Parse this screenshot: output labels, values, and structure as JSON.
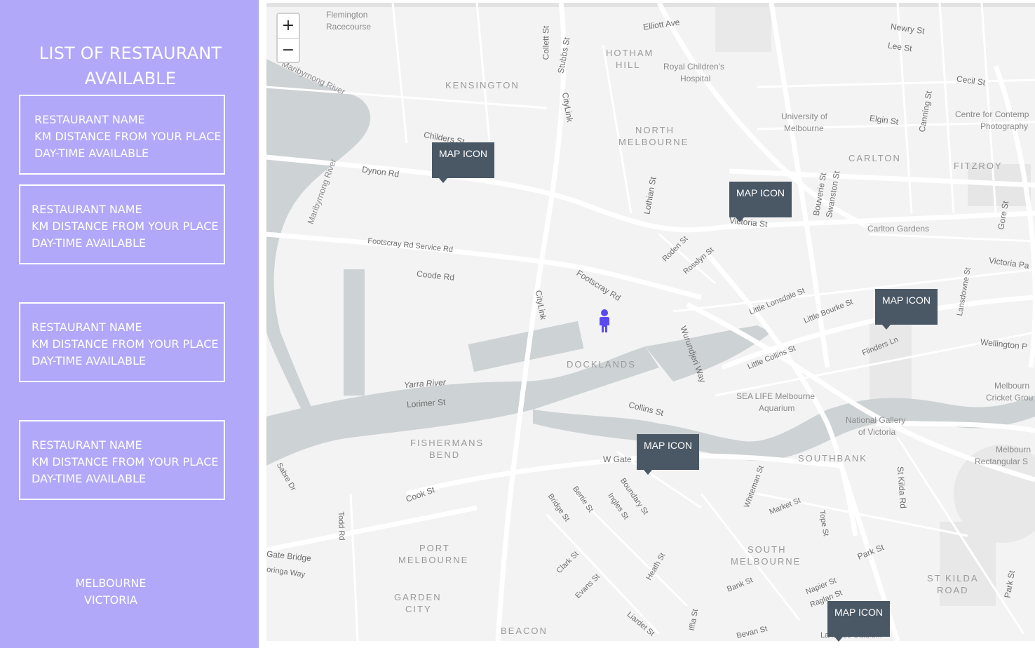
{
  "sidebar": {
    "title_line1": "LIST OF RESTAURANT",
    "title_line2": "AVAILABLE",
    "cards": [
      {
        "name": "RESTAURANT NAME",
        "distance": "KM DISTANCE FROM YOUR PLACE",
        "time": "DAY-TIME AVAILABLE"
      },
      {
        "name": "RESTAURANT NAME",
        "distance": "KM DISTANCE FROM YOUR PLACE",
        "time": "DAY-TIME AVAILABLE"
      },
      {
        "name": "RESTAURANT NAME",
        "distance": "KM DISTANCE FROM YOUR PLACE",
        "time": "DAY-TIME AVAILABLE"
      },
      {
        "name": "RESTAURANT NAME",
        "distance": "KM DISTANCE FROM YOUR PLACE",
        "time": "DAY-TIME AVAILABLE"
      }
    ],
    "location_line1": "MELBOURNE",
    "location_line2": "VICTORIA"
  },
  "map": {
    "zoom_in": "+",
    "zoom_out": "−",
    "markers": [
      "MAP ICON",
      "MAP ICON",
      "MAP ICON",
      "MAP ICON",
      "MAP ICON"
    ],
    "user_icon": "person-icon",
    "labels": {
      "flemington": "Flemington",
      "racecourse": "Racecourse",
      "elliott": "Elliott Ave",
      "newry": "Newry St",
      "lee": "Lee St",
      "hotham1": "HOTHAM",
      "hotham2": "HILL",
      "royal1": "Royal Children's",
      "royal2": "Hospital",
      "kensington": "KENSINGTON",
      "maribyrnong": "Maribyrnong River",
      "collett": "Collett St",
      "stubbs": "Stubbs St",
      "citylink1": "CityLink",
      "northmelb1": "NORTH",
      "northmelb2": "MELBOURNE",
      "unimelb1": "University of",
      "unimelb2": "Melbourne",
      "elgin": "Elgin St",
      "canning": "Canning St",
      "carlton": "CARLTON",
      "cecil": "Cecil St",
      "centre1": "Centre for Contemp",
      "centre2": "Photography",
      "fitzroy": "FITZROY",
      "childers": "Childers St",
      "dynon": "Dynon Rd",
      "maribyrnong2": "Maribyrnong River",
      "lothian": "Lothian St",
      "victoria": "Victoria St",
      "bouverie": "Bouverie St",
      "swanston": "Swanston St",
      "carlton_gardens": "Carlton Gardens",
      "gore": "Gore St",
      "victoria_pa": "Victoria Pa",
      "footscray_service": "Footscray Rd Service Rd",
      "roden": "Roden St",
      "rosslyn": "Rosslyn St",
      "coode": "Coode Rd",
      "footscray": "Footscray Rd",
      "little_lonsdale": "Little Lonsdale St",
      "little_bourke": "Little Bourke St",
      "lansdowne": "Lansdowne St",
      "citylink2": "CityLink",
      "wurundjeri": "Wurundjeri Way",
      "docklands": "DOCKLANDS",
      "little_collins": "Little Collins St",
      "flinders_ln": "Flinders Ln",
      "wellington": "Wellington P",
      "yarra": "Yarra River",
      "lorimer": "Lorimer St",
      "collins": "Collins St",
      "sealife1": "SEA LIFE Melbourne",
      "sealife2": "Aquarium",
      "mcg1": "Melbourn",
      "mcg2": "Cricket Grou",
      "ngv1": "National Gallery",
      "ngv2": "of Victoria",
      "fishermans1": "FISHERMANS",
      "fishermans2": "BEND",
      "wgate": "W Gate",
      "southbank": "SOUTHBANK",
      "rect1": "Melbourn",
      "rect2": "Rectangular S",
      "sabre": "Sabre Dr",
      "whiteman": "Whiteman St",
      "stkilda_rd": "St Kilda Rd",
      "cook": "Cook St",
      "bertie": "Bertie St",
      "boundary": "Boundary St",
      "bridge": "Bridge St",
      "ingles": "Ingles St",
      "market": "Market St",
      "tope": "Tope St",
      "todd": "Todd Rd",
      "portmelb1": "PORT",
      "portmelb2": "MELBOURNE",
      "southmelb1": "SOUTH",
      "southmelb2": "MELBOURNE",
      "park": "Park St",
      "gate_bridge": "Gate Bridge",
      "oringa": "oringa Way",
      "clark": "Clark St",
      "evans": "Evans St",
      "heath": "Heath St",
      "stkilda1": "ST KILDA",
      "stkilda2": "ROAD",
      "park2": "Park St",
      "bank": "Bank St",
      "napier": "Napier St",
      "raglan": "Raglan St",
      "garden1": "GARDEN",
      "garden2": "CITY",
      "beacon": "BEACON",
      "liardet": "Liardet St",
      "iffla": "Iffla St",
      "bevan": "Bevan St",
      "lakeside": "Lakeside Stadium"
    }
  }
}
